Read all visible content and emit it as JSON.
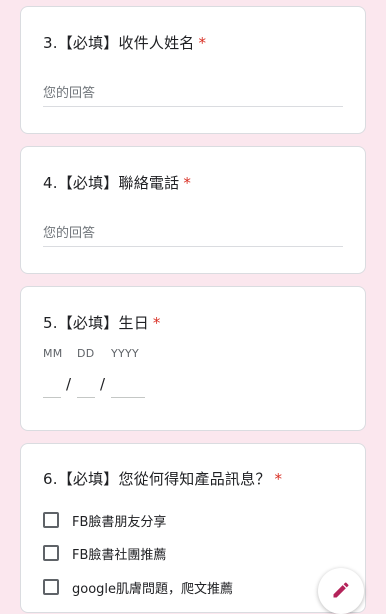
{
  "questions": [
    {
      "number_title": "3.【必填】收件人姓名",
      "required_mark": "*",
      "placeholder": "您的回答"
    },
    {
      "number_title": "4.【必填】聯絡電話",
      "required_mark": "*",
      "placeholder": "您的回答"
    },
    {
      "number_title": "5.【必填】生日",
      "required_mark": "*",
      "date_labels": {
        "month": "MM",
        "day": "DD",
        "year": "YYYY"
      },
      "separator": "/"
    },
    {
      "number_title": "6.【必填】您從何得知產品訊息？",
      "required_mark": "*",
      "options": [
        "FB臉書朋友分享",
        "FB臉書社團推薦",
        "google肌膚問題，爬文推薦"
      ]
    }
  ],
  "colors": {
    "page_bg": "#fbe7ee",
    "required": "#d93025",
    "accent": "#b4235a"
  },
  "icons": {
    "fab": "pencil-icon"
  }
}
